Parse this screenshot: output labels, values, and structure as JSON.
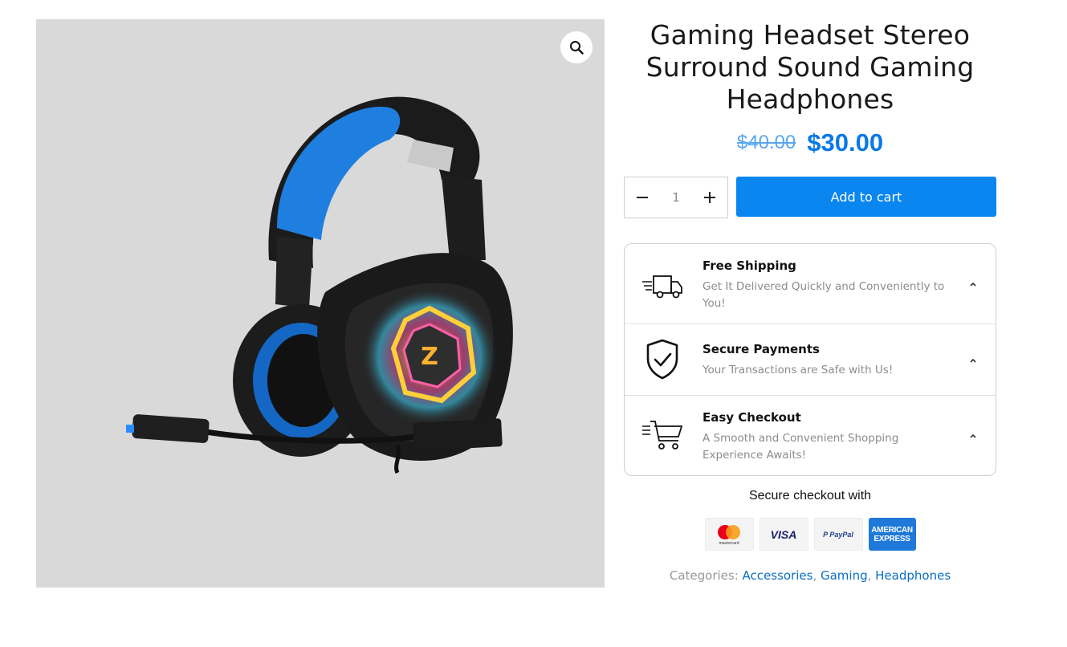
{
  "product": {
    "title": "Gaming Headset Stereo Surround Sound Gaming Headphones",
    "regular_price": "$40.00",
    "sale_price": "$30.00",
    "image_icon": "headset-product-image"
  },
  "gallery": {
    "zoom_icon": "magnifier-icon"
  },
  "cart": {
    "quantity": "1",
    "minus_icon": "minus-icon",
    "plus_icon": "plus-icon",
    "add_label": "Add to cart"
  },
  "features": [
    {
      "title": "Free Shipping",
      "desc": "Get It Delivered Quickly and Conveniently to You!",
      "icon": "truck-icon"
    },
    {
      "title": "Secure Payments",
      "desc": "Your Transactions are Safe with Us!",
      "icon": "shield-check-icon"
    },
    {
      "title": "Easy Checkout",
      "desc": "A Smooth and Convenient Shopping Experience Awaits!",
      "icon": "cart-icon"
    }
  ],
  "checkout": {
    "label": "Secure checkout with",
    "methods": [
      {
        "name": "mastercard",
        "text": "mastercard"
      },
      {
        "name": "visa",
        "text": "VISA"
      },
      {
        "name": "paypal",
        "text": "PayPal"
      },
      {
        "name": "amex",
        "line1": "AMERICAN",
        "line2": "EXPRESS"
      }
    ]
  },
  "categories": {
    "label": "Categories:",
    "items": [
      "Accessories",
      "Gaming",
      "Headphones"
    ]
  },
  "colors": {
    "accent": "#0a86f0",
    "price": "#0a78e6",
    "old_price": "#5aa7ee",
    "link": "#0a6fc2"
  }
}
